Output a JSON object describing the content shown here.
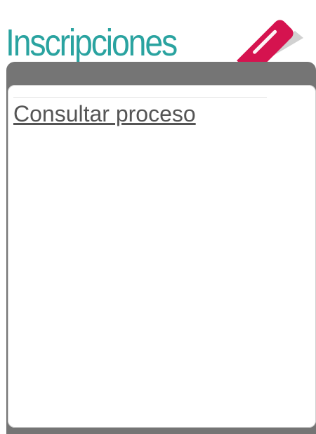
{
  "header": {
    "title": "Inscripciones",
    "title_color": "#2aa3a0",
    "icon": "pencil-icon",
    "icon_color": "#d5134f"
  },
  "panel": {
    "header_color": "#757575",
    "link_label": "Consultar proceso",
    "link_color": "#555555"
  }
}
